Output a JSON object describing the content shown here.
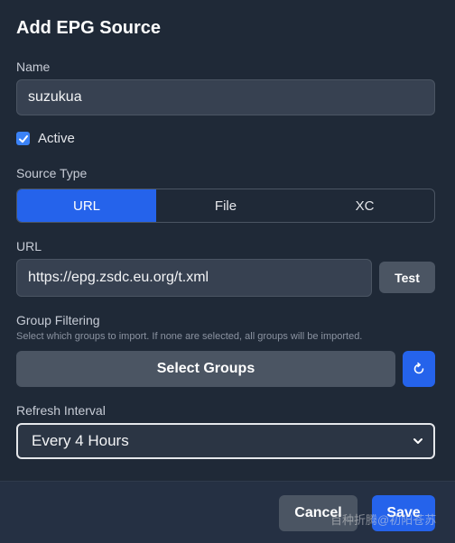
{
  "dialog": {
    "title": "Add EPG Source",
    "name_label": "Name",
    "name_value": "suzukua",
    "active_label": "Active",
    "active_checked": true,
    "source_type_label": "Source Type",
    "source_types": [
      "URL",
      "File",
      "XC"
    ],
    "source_type_selected": "URL",
    "url_label": "URL",
    "url_value": "https://epg.zsdc.eu.org/t.xml",
    "test_label": "Test",
    "group_filtering_label": "Group Filtering",
    "group_filtering_hint": "Select which groups to import. If none are selected, all groups will be imported.",
    "select_groups_label": "Select Groups",
    "refresh_icon": "refresh-icon",
    "refresh_interval_label": "Refresh Interval",
    "refresh_interval_value": "Every 4 Hours",
    "cancel_label": "Cancel",
    "save_label": "Save",
    "watermark": "百种折腾@初阳苍苏"
  },
  "colors": {
    "background": "#1f2937",
    "input": "#374151",
    "accent": "#2563eb",
    "button_gray": "#4b5563"
  }
}
